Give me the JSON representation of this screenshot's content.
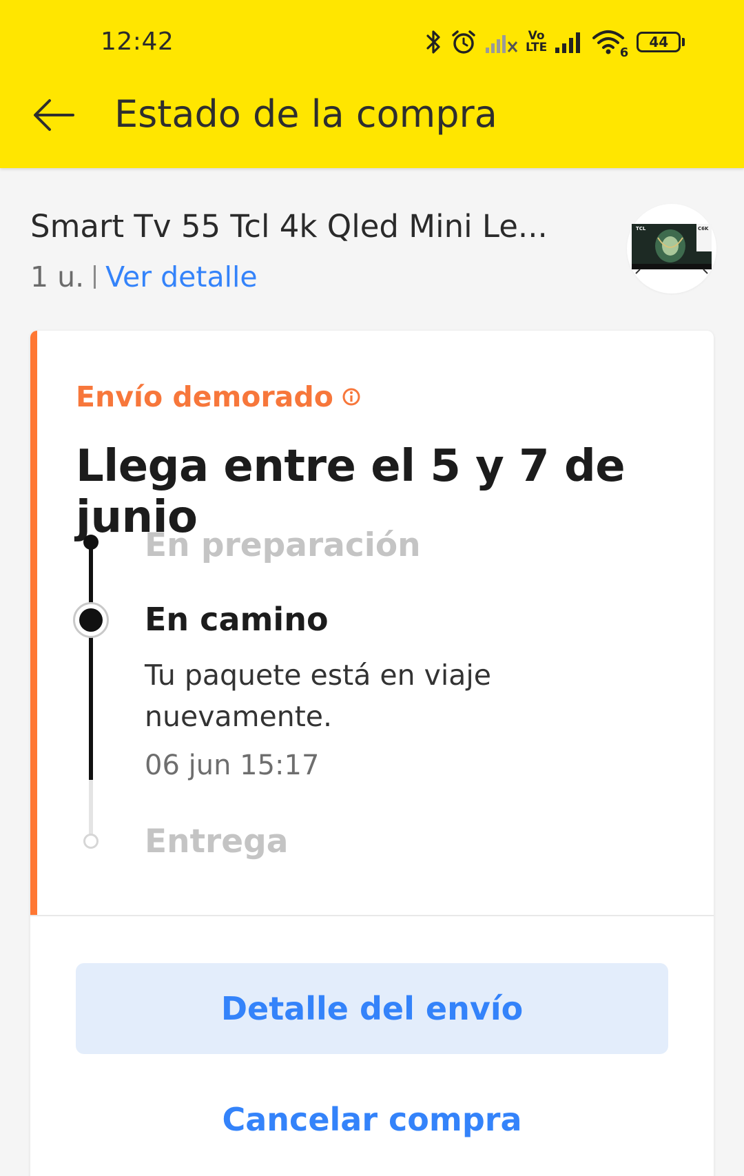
{
  "status_bar": {
    "time": "12:42",
    "icons": [
      "bluetooth-icon",
      "alarm-icon",
      "signal-off-icon",
      "volte-icon",
      "signal-icon",
      "wifi-icon",
      "battery-icon"
    ],
    "volte_label_top": "Vo",
    "volte_label_bottom": "LTE",
    "wifi_badge": "6",
    "battery": "44"
  },
  "app_bar": {
    "title": "Estado de la compra",
    "background": "#ffe600"
  },
  "product": {
    "title": "Smart Tv 55 Tcl 4k Qled Mini Le...",
    "quantity": "1 u.",
    "detail_link": "Ver detalle",
    "thumbnail_brand": "TCL",
    "thumbnail_model": "C6K"
  },
  "shipment": {
    "status_label": "Envío demorado",
    "status_color": "#f7773b",
    "eta": "Llega entre el 5 y 7 de junio",
    "steps": [
      {
        "label": "En preparación",
        "state": "done"
      },
      {
        "label": "En camino",
        "state": "current",
        "description": "Tu paquete está en viaje nuevamente.",
        "date": "06 jun 15:17"
      },
      {
        "label": "Entrega",
        "state": "pending"
      }
    ]
  },
  "actions": {
    "detail_button": "Detalle del envío",
    "cancel_button": "Cancelar compra",
    "accent": "#3483fa"
  }
}
